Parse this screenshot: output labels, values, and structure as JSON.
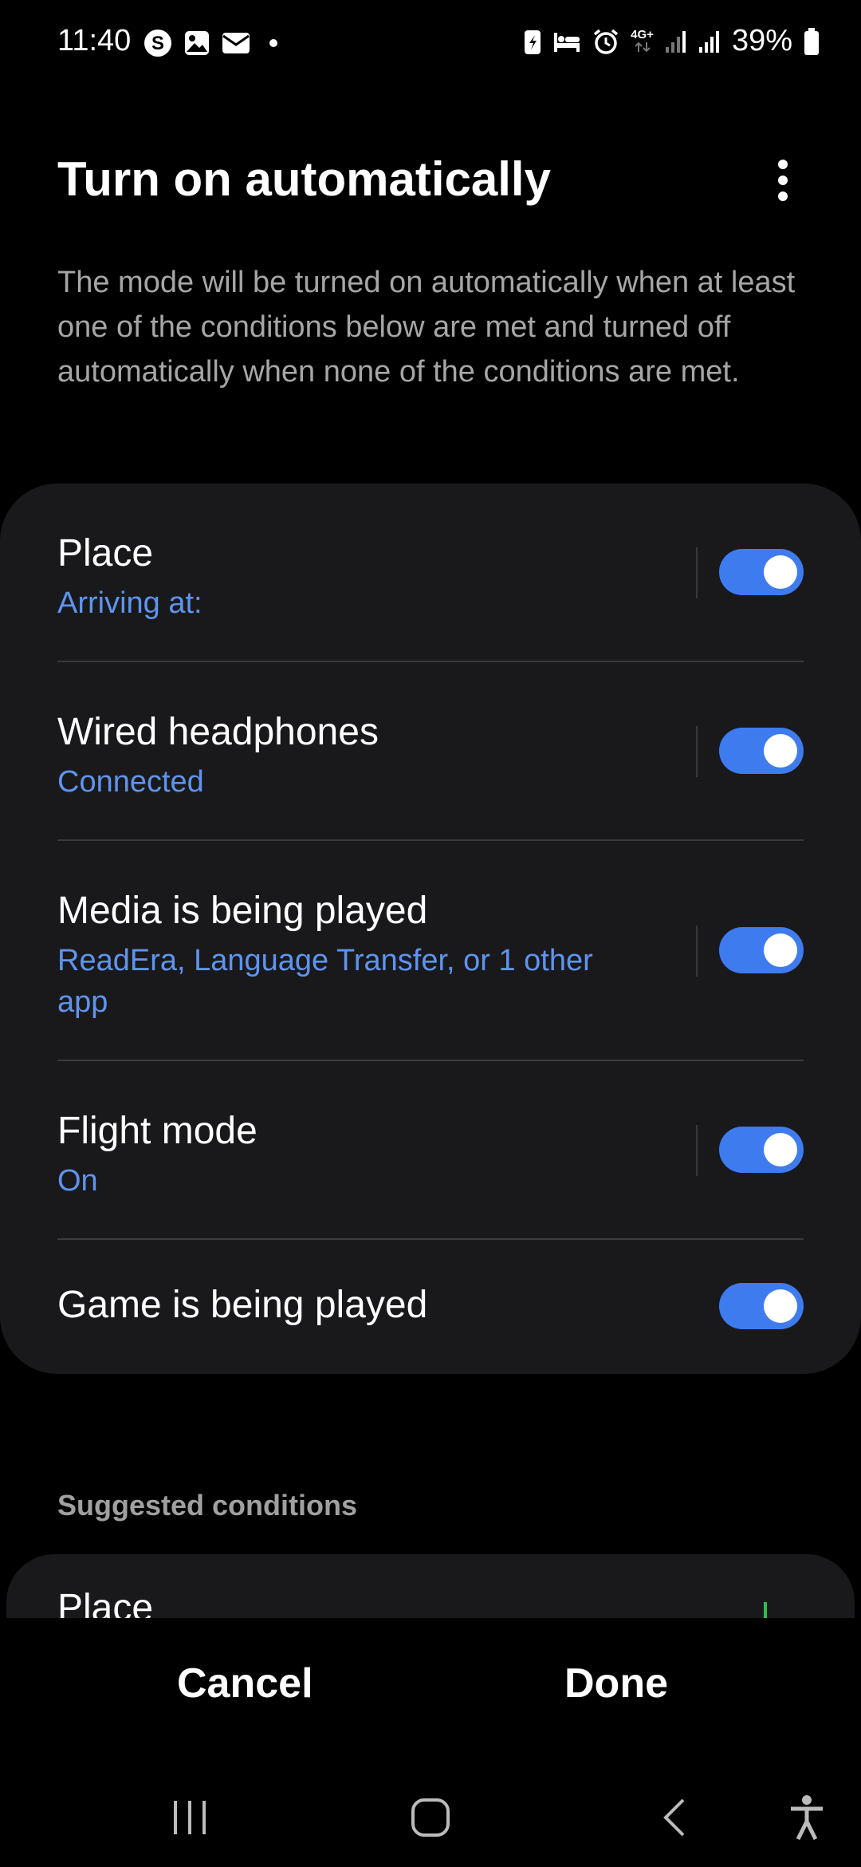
{
  "status_bar": {
    "time": "11:40",
    "network": "4G+",
    "battery": "39%",
    "icons_left": [
      "s-app-icon",
      "gallery-icon",
      "mail-icon",
      "dot-icon"
    ],
    "icons_right": [
      "battery-saver-icon",
      "bed-icon",
      "alarm-icon",
      "network-4g-icon",
      "signal-icon",
      "signal-icon",
      "battery-icon"
    ]
  },
  "header": {
    "title": "Turn on automatically",
    "description": "The mode will be turned on automatically when at least one of the conditions below are met and turned off automatically when none of the conditions are met."
  },
  "conditions": [
    {
      "title": "Place",
      "subtitle": "Arriving at:",
      "enabled": true
    },
    {
      "title": "Wired headphones",
      "subtitle": "Connected",
      "enabled": true
    },
    {
      "title": "Media is being played",
      "subtitle": "ReadEra, Language Transfer, or 1 other app",
      "enabled": true
    },
    {
      "title": "Flight mode",
      "subtitle": "On",
      "enabled": true
    },
    {
      "title": "Game is being played",
      "subtitle": "",
      "enabled": true
    }
  ],
  "suggested": {
    "label": "Suggested conditions",
    "first_item": "Place"
  },
  "actions": {
    "cancel": "Cancel",
    "done": "Done"
  },
  "colors": {
    "accent": "#3e7bef",
    "subtitle": "#5f94ee",
    "card": "#19191b",
    "background": "#000000"
  }
}
